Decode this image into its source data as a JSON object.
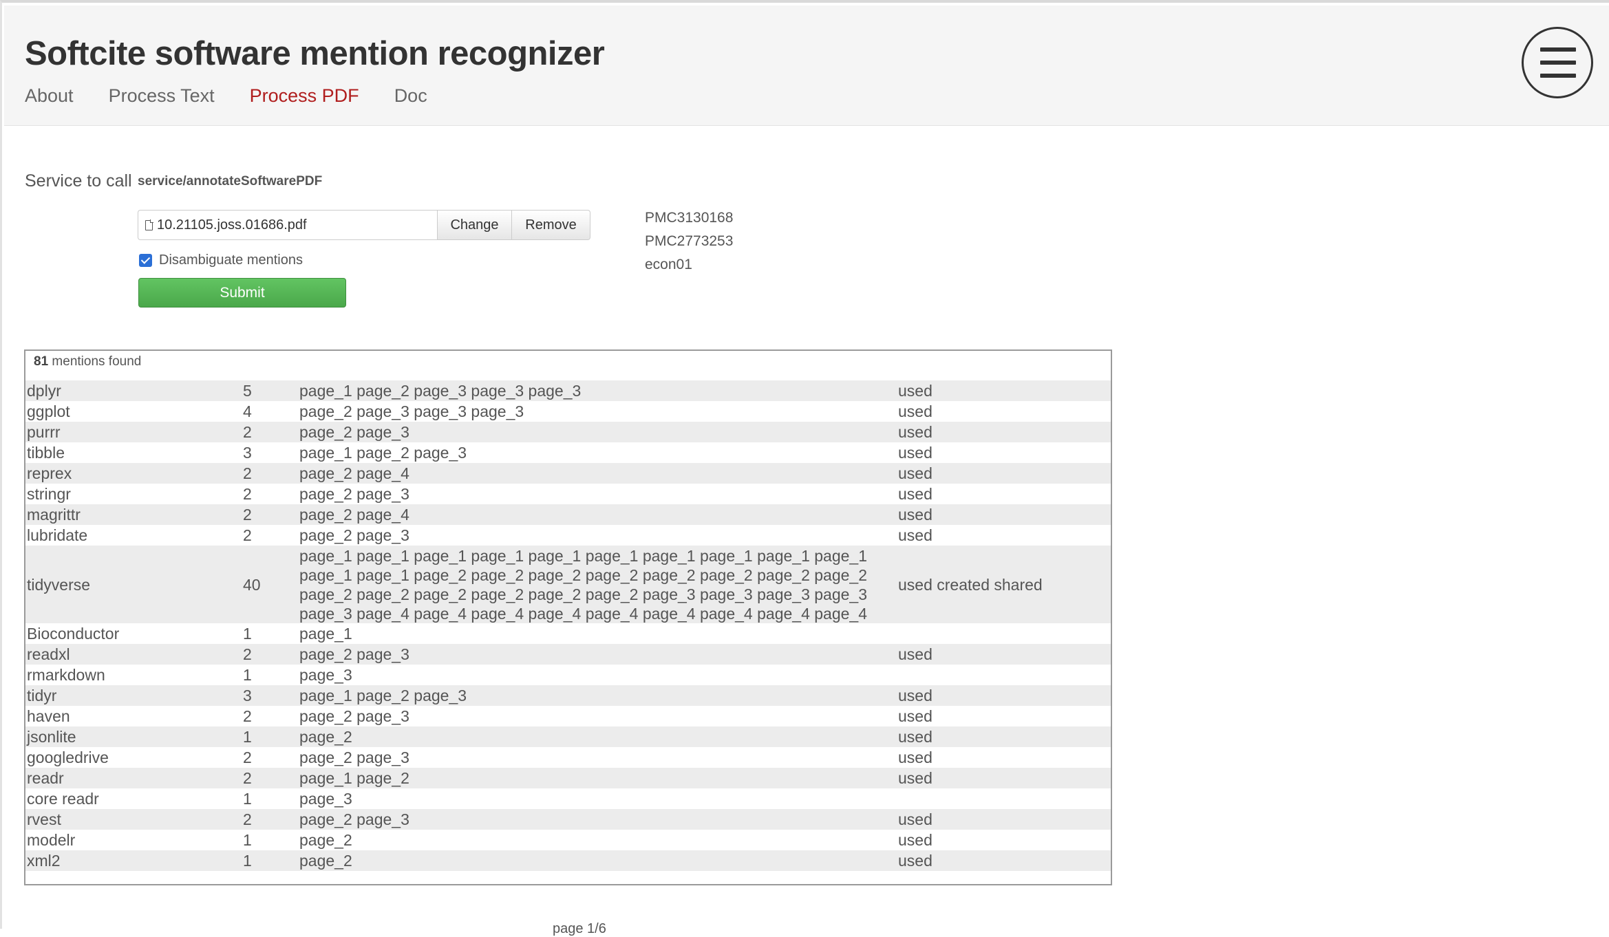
{
  "app": {
    "title": "Softcite software mention recognizer"
  },
  "nav": {
    "items": [
      {
        "label": "About",
        "active": false
      },
      {
        "label": "Process Text",
        "active": false
      },
      {
        "label": "Process PDF",
        "active": true
      },
      {
        "label": "Doc",
        "active": false
      }
    ],
    "menu_icon": "hamburger-menu-icon"
  },
  "form": {
    "service_label": "Service to call",
    "service_value": "service/annotateSoftwarePDF",
    "file_icon": "file-icon",
    "file_name": "10.21105.joss.01686.pdf",
    "change_label": "Change",
    "remove_label": "Remove",
    "disambiguate_label": "Disambiguate mentions",
    "disambiguate_checked": true,
    "submit_label": "Submit"
  },
  "examples": [
    "PMC3130168",
    "PMC2773253",
    "econ01"
  ],
  "colors": {
    "accent_active_nav": "#b01e1e",
    "submit_green": "#5cb85c",
    "checkbox_blue": "#2b6fd6",
    "stripe_gray": "#ececec"
  },
  "results": {
    "count": "81",
    "count_suffix": "mentions found",
    "rows": [
      {
        "name": "dplyr",
        "count": "5",
        "pages": "page_1 page_2 page_3 page_3 page_3",
        "types": "used"
      },
      {
        "name": "ggplot",
        "count": "4",
        "pages": "page_2 page_3 page_3 page_3",
        "types": "used"
      },
      {
        "name": "purrr",
        "count": "2",
        "pages": "page_2 page_3",
        "types": "used"
      },
      {
        "name": "tibble",
        "count": "3",
        "pages": "page_1 page_2 page_3",
        "types": "used"
      },
      {
        "name": "reprex",
        "count": "2",
        "pages": "page_2 page_4",
        "types": "used"
      },
      {
        "name": "stringr",
        "count": "2",
        "pages": "page_2 page_3",
        "types": "used"
      },
      {
        "name": "magrittr",
        "count": "2",
        "pages": "page_2 page_4",
        "types": "used"
      },
      {
        "name": "lubridate",
        "count": "2",
        "pages": "page_2 page_3",
        "types": "used"
      },
      {
        "name": "tidyverse",
        "count": "40",
        "pages": "page_1 page_1 page_1 page_1 page_1 page_1 page_1 page_1 page_1 page_1 page_1 page_1 page_2 page_2 page_2 page_2 page_2 page_2 page_2 page_2 page_2 page_2 page_2 page_2 page_2 page_2 page_3 page_3 page_3 page_3 page_3 page_4 page_4 page_4 page_4 page_4 page_4 page_4 page_4 page_4",
        "types": "used created shared"
      },
      {
        "name": "Bioconductor",
        "count": "1",
        "pages": "page_1",
        "types": ""
      },
      {
        "name": "readxl",
        "count": "2",
        "pages": "page_2 page_3",
        "types": "used"
      },
      {
        "name": "rmarkdown",
        "count": "1",
        "pages": "page_3",
        "types": ""
      },
      {
        "name": "tidyr",
        "count": "3",
        "pages": "page_1 page_2 page_3",
        "types": "used"
      },
      {
        "name": "haven",
        "count": "2",
        "pages": "page_2 page_3",
        "types": "used"
      },
      {
        "name": "jsonlite",
        "count": "1",
        "pages": "page_2",
        "types": "used"
      },
      {
        "name": "googledrive",
        "count": "2",
        "pages": "page_2 page_3",
        "types": "used"
      },
      {
        "name": "readr",
        "count": "2",
        "pages": "page_1 page_2",
        "types": "used"
      },
      {
        "name": "core readr",
        "count": "1",
        "pages": "page_3",
        "types": ""
      },
      {
        "name": "rvest",
        "count": "2",
        "pages": "page_2 page_3",
        "types": "used"
      },
      {
        "name": "modelr",
        "count": "1",
        "pages": "page_2",
        "types": "used"
      },
      {
        "name": "xml2",
        "count": "1",
        "pages": "page_2",
        "types": "used"
      }
    ]
  },
  "pagination": {
    "label": "page 1/6"
  }
}
